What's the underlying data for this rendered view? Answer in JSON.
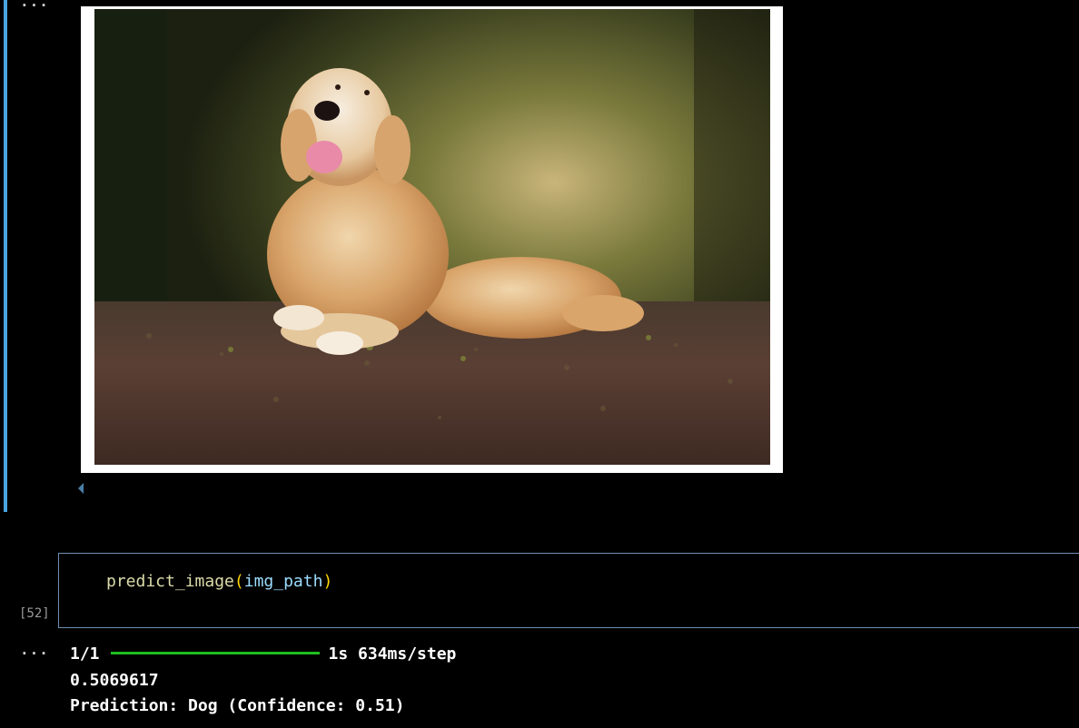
{
  "output_toggle_top": "...",
  "output_toggle_bottom": "...",
  "image": {
    "subject": "golden retriever lying on forest path"
  },
  "code_cell": {
    "execution_count": "[52]",
    "function_name": "predict_image",
    "open_paren": "(",
    "argument": "img_path",
    "close_paren": ")"
  },
  "output": {
    "progress_count": "1/1",
    "progress_fraction": 1.0,
    "timing": "1s 634ms/step",
    "raw_value": "0.5069617",
    "prediction": "Prediction: Dog (Confidence: 0.51)"
  },
  "colors": {
    "cell_indicator": "#4aa3df",
    "progress_bar": "#1fbd1f",
    "code_border": "#6f8fb3",
    "function": "#dcdcaa",
    "variable": "#9cdcfe",
    "bracket": "#ffd700"
  }
}
